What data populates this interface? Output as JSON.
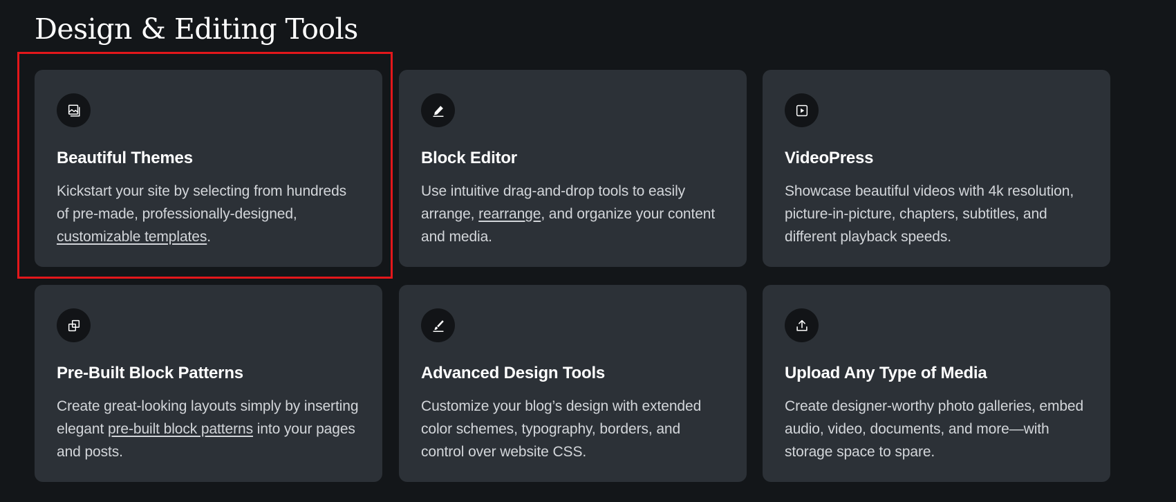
{
  "section": {
    "title": "Design & Editing Tools"
  },
  "colors": {
    "background": "#131619",
    "card": "#2c3137",
    "icon_circle": "#121417",
    "highlight": "#e3171b"
  },
  "cards": [
    {
      "icon": "themes-image-icon",
      "title": "Beautiful Themes",
      "desc_before": "Kickstart your site by selecting from hundreds of pre-made, professionally-designed, ",
      "link": "customizable templates",
      "desc_after": "."
    },
    {
      "icon": "pencil-icon",
      "title": "Block Editor",
      "desc_before": "Use intuitive drag-and-drop tools to easily arrange, ",
      "link": "rearrange",
      "desc_after": ", and organize your content and media."
    },
    {
      "icon": "video-play-icon",
      "title": "VideoPress",
      "desc_before": "Showcase beautiful videos with 4k resolution, picture-in-picture, chapters, subtitles, and different playback speeds.",
      "link": "",
      "desc_after": ""
    },
    {
      "icon": "block-patterns-icon",
      "title": "Pre-Built Block Patterns",
      "desc_before": "Create great-looking layouts simply by inserting elegant ",
      "link": "pre-built block patterns",
      "desc_after": " into your pages and posts."
    },
    {
      "icon": "brush-icon",
      "title": "Advanced Design Tools",
      "desc_before": "Customize your blog’s design with extended color schemes, typography, borders, and control over website CSS.",
      "link": "",
      "desc_after": ""
    },
    {
      "icon": "upload-icon",
      "title": "Upload Any Type of Media",
      "desc_before": "Create designer-worthy photo galleries, embed audio, video, documents, and more—with storage space to spare.",
      "link": "",
      "desc_after": ""
    }
  ]
}
